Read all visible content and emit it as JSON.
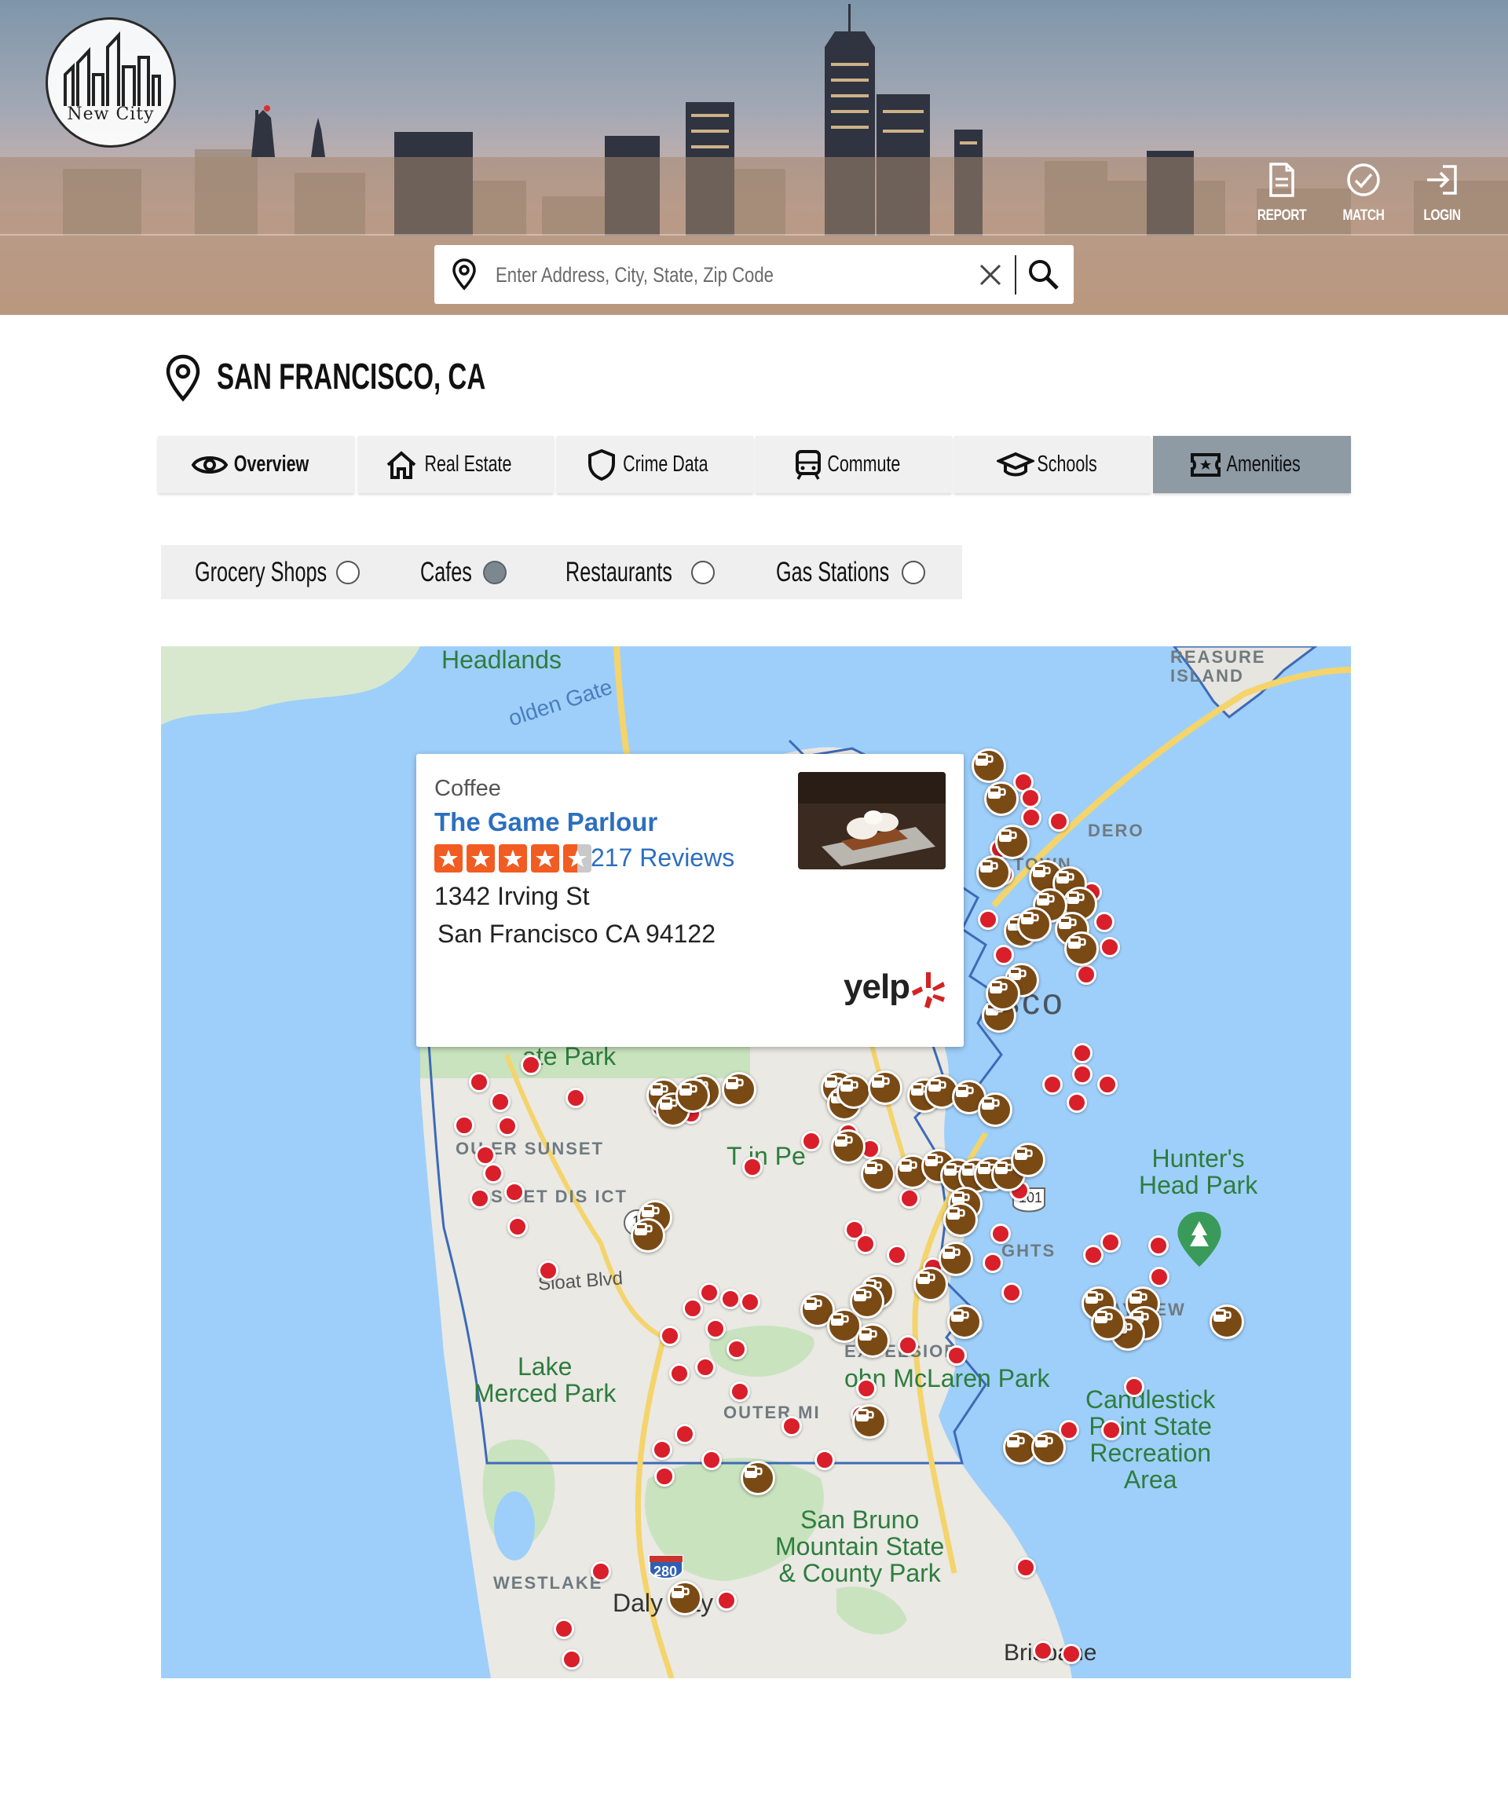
{
  "brand": {
    "logo_text": "New City"
  },
  "header_nav": [
    {
      "label": "REPORT",
      "icon": "document-icon"
    },
    {
      "label": "MATCH",
      "icon": "check-circle-icon"
    },
    {
      "label": "LOGIN",
      "icon": "login-icon"
    }
  ],
  "search": {
    "placeholder": "Enter Address, City, State, Zip Code",
    "value": ""
  },
  "location": {
    "title": "SAN FRANCISCO, CA"
  },
  "tabs": [
    {
      "label": "Overview",
      "icon": "eye-icon",
      "active": false
    },
    {
      "label": "Real Estate",
      "icon": "house-icon",
      "active": false
    },
    {
      "label": "Crime Data",
      "icon": "shield-icon",
      "active": false
    },
    {
      "label": "Commute",
      "icon": "train-icon",
      "active": false
    },
    {
      "label": "Schools",
      "icon": "graduation-cap-icon",
      "active": false
    },
    {
      "label": "Amenities",
      "icon": "ticket-icon",
      "active": true
    }
  ],
  "filters": [
    {
      "label": "Grocery Shops",
      "selected": false
    },
    {
      "label": "Cafes",
      "selected": true
    },
    {
      "label": "Restaurants",
      "selected": false
    },
    {
      "label": "Gas Stations",
      "selected": false
    }
  ],
  "map": {
    "labels": {
      "headlands": "Headlands",
      "golden_gate": "olden Gate",
      "treasure_island": "REASURE\nISLAND",
      "embarcadero": "DERO",
      "chinatown": "TOWN",
      "francisco": "sco",
      "gate_park": "ate Park",
      "outer_sunset": "OU ER SUNSET",
      "sunset_district": "S SET DIS ICT",
      "twin_peaks": "T in Pe",
      "hunters_point": "Hunter's\nHead Park",
      "heights": "GHTS",
      "bayview": "AYVIEW",
      "sloat": "Sloat Blvd",
      "lake_merced": "Lake\nMerced Park",
      "excelsior": "EXCELSIOR",
      "mclaren": "ohn McLaren Park",
      "outer_mission": "OUTER MI",
      "candlestick": "Candlestick\nPoint State\nRecreation\nArea",
      "san_bruno": "San Bruno\nMountain State\n& County Park",
      "westlake": "WESTLAKE",
      "daly_city": "Daly City",
      "brisbane": "Brisbane",
      "hwy_101": "101",
      "hwy_280": "280",
      "hwy_1": "1"
    }
  },
  "popup": {
    "category": "Coffee",
    "name": "The Game Parlour",
    "rating": 4.5,
    "reviews": "217 Reviews",
    "address_line1": "1342 Irving St",
    "address_line2": "San Francisco CA 94122",
    "provider": "yelp"
  },
  "colors": {
    "accent_blue": "#2d6fbe",
    "marker_red": "#d81f2a",
    "marker_cafe": "#7a4a15",
    "tab_active": "#8e9aa4",
    "yelp_red": "#d32323"
  }
}
